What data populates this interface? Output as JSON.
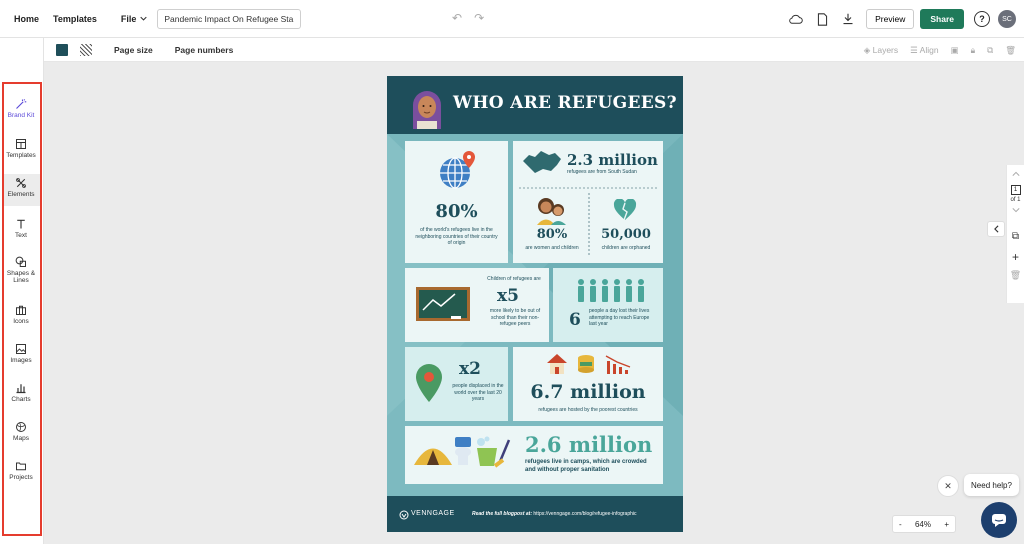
{
  "topbar": {
    "home": "Home",
    "templates": "Templates",
    "file": "File",
    "doc_title": "Pandemic Impact On Refugee Sta...",
    "preview": "Preview",
    "share": "Share",
    "help": "?",
    "avatar_initials": "SC"
  },
  "subbar": {
    "page_size": "Page size",
    "page_numbers": "Page numbers",
    "layers": "Layers",
    "align": "Align",
    "swatch_color": "#1f4f5a"
  },
  "sidebar": {
    "items": [
      {
        "label": "Brand Kit",
        "icon": "magic-wand-icon"
      },
      {
        "label": "Templates",
        "icon": "templates-icon"
      },
      {
        "label": "Elements",
        "icon": "elements-icon"
      },
      {
        "label": "Text",
        "icon": "text-icon"
      },
      {
        "label": "Shapes & Lines",
        "icon": "shapes-icon"
      },
      {
        "label": "Icons",
        "icon": "briefcase-icon"
      },
      {
        "label": "Images",
        "icon": "image-icon"
      },
      {
        "label": "Charts",
        "icon": "bar-chart-icon"
      },
      {
        "label": "Maps",
        "icon": "globe-icon"
      },
      {
        "label": "Projects",
        "icon": "folder-icon"
      }
    ],
    "highlight_color": "#e53c2e",
    "active_item": "Elements"
  },
  "infographic": {
    "title": "WHO ARE REFUGEES?",
    "stat_80_world": "80%",
    "stat_80_world_desc": "of the world's refugees live in the neighboring countries of their country of origin",
    "stat_south_sudan": "2.3 million",
    "stat_south_sudan_desc": "refugees are from South Sudan",
    "stat_80_women": "80%",
    "stat_80_women_desc": "are women and children",
    "stat_orphaned": "50,000",
    "stat_orphaned_desc": "children are orphaned",
    "children_intro": "Children of refugees are",
    "stat_x5": "x5",
    "stat_x5_desc": "more likely to be out of school than their non-refugee peers",
    "stat_6": "6",
    "stat_6_desc": "people a day lost their lives attempting to reach Europe last year",
    "stat_x2": "x2",
    "stat_x2_desc": "people displaced in the world over the last 20 years",
    "stat_6_7": "6.7 million",
    "stat_6_7_desc": "refugees are hosted by the poorest countries",
    "stat_2_6": "2.6 million",
    "stat_2_6_desc": "refugees live in camps, which are crowded and without proper sanitation",
    "footer_logo": "VENNGAGE",
    "footer_text_bold": "Read the full blogpost at:",
    "footer_url": "https://venngage.com/blog/refugee-infographic",
    "colors": {
      "dark": "#1e4e5b",
      "teal": "#79b7bd",
      "accent": "#4aa69a"
    }
  },
  "rail": {
    "page": "1",
    "of": "of 1"
  },
  "zoom": {
    "minus": "-",
    "value": "64%",
    "plus": "+"
  },
  "help_widget": {
    "close": "✕",
    "label": "Need help?"
  }
}
